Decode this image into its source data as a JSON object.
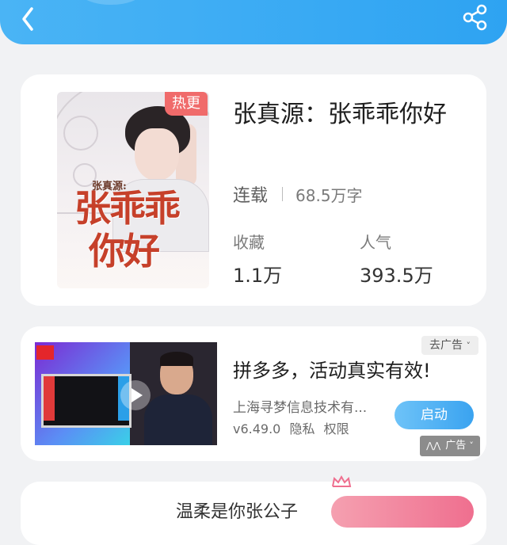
{
  "header": {
    "back_icon": "chevron-left-icon",
    "share_icon": "share-icon",
    "gradient": [
      "#4ab4f5",
      "#2ea3f2"
    ]
  },
  "book": {
    "badge": "热更",
    "title": "张真源：张乖乖你好",
    "status": "连载",
    "word_count": "68.5万字",
    "stats": {
      "favorites_label": "收藏",
      "favorites_value": "1.1万",
      "popularity_label": "人气",
      "popularity_value": "393.5万"
    },
    "cover": {
      "small_title": "张真源:",
      "title_line1": "张乖乖",
      "title_line2": "你好",
      "title_color": "#c6402a"
    }
  },
  "ad": {
    "title": "拼多多，活动真实有效!",
    "company": "上海寻梦信息技术有...",
    "version": "v6.49.0",
    "privacy": "隐私",
    "permissions": "权限",
    "launch_label": "启动",
    "remove_label": "去广告",
    "tag_label": "广告",
    "accent": "#3aa3f0"
  },
  "bottom": {
    "partial_text": "温柔是你张公子"
  }
}
